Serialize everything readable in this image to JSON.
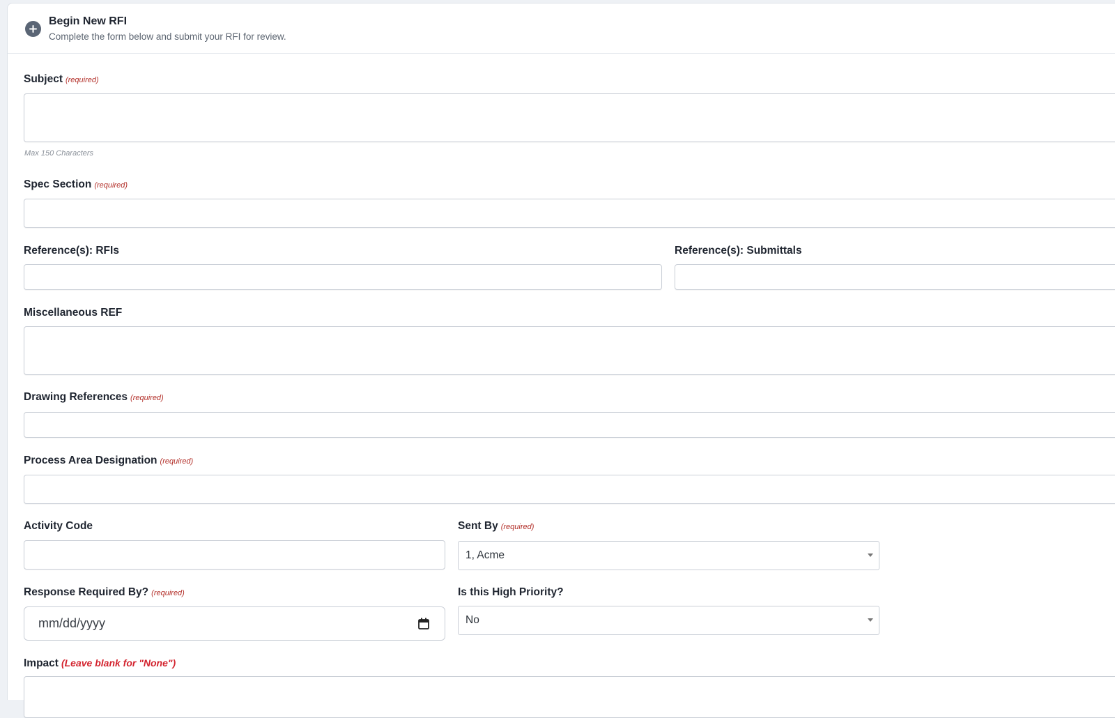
{
  "header": {
    "title": "Begin New RFI",
    "subtitle": "Complete the form below and submit your RFI for review."
  },
  "required_text": "(required)",
  "fields": {
    "subject": {
      "label": "Subject",
      "value": "",
      "help": "Max 150 Characters"
    },
    "spec_section": {
      "label": "Spec Section",
      "value": ""
    },
    "ref_rfis": {
      "label": "Reference(s): RFIs",
      "value": ""
    },
    "ref_submittals": {
      "label": "Reference(s): Submittals",
      "value": ""
    },
    "misc_ref": {
      "label": "Miscellaneous REF",
      "value": ""
    },
    "drawing_refs": {
      "label": "Drawing References",
      "value": ""
    },
    "process_area": {
      "label": "Process Area Designation",
      "value": ""
    },
    "activity_code": {
      "label": "Activity Code",
      "value": ""
    },
    "sent_by": {
      "label": "Sent By",
      "selected": "1, Acme"
    },
    "response_required_by": {
      "label": "Response Required By?",
      "placeholder": "mm/dd/yyyy"
    },
    "high_priority": {
      "label": "Is this High Priority?",
      "selected": "No"
    },
    "impact": {
      "label": "Impact",
      "note": "(Leave blank for \"None\")"
    }
  },
  "icons": {
    "header": "plus-circle-icon",
    "date": "calendar-icon",
    "dropdown": "caret-down-icon"
  },
  "colors": {
    "required": "#b3302a",
    "impact_note": "#d3232e",
    "header_icon": "#5a6575"
  }
}
